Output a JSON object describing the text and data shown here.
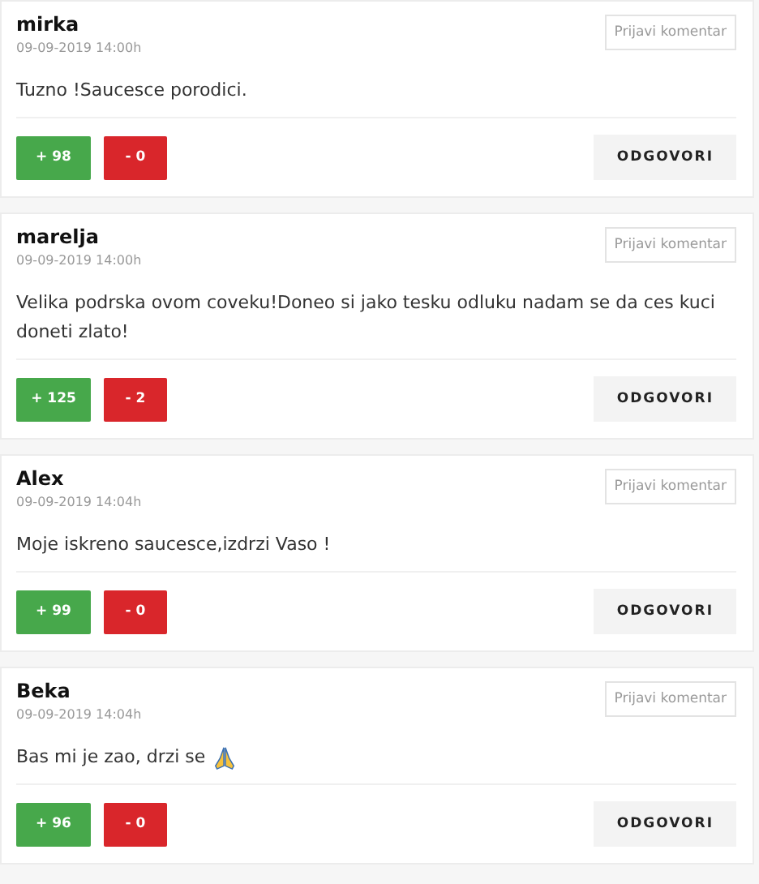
{
  "comments": [
    {
      "author": "mirka",
      "date": "09-09-2019 14:00h",
      "text": "Tuzno !Saucesce porodici.",
      "emoji": false,
      "report": "Prijavi komentar",
      "likes": "+ 98",
      "dislikes": "- 0",
      "reply": "ODGOVORI"
    },
    {
      "author": "marelja",
      "date": "09-09-2019 14:00h",
      "text": "Velika podrska ovom coveku!Doneo si jako tesku odluku nadam se da ces kuci doneti zlato!",
      "emoji": false,
      "report": "Prijavi komentar",
      "likes": "+ 125",
      "dislikes": "- 2",
      "reply": "ODGOVORI"
    },
    {
      "author": "Alex",
      "date": "09-09-2019 14:04h",
      "text": "Moje iskreno saucesce,izdrzi Vaso !",
      "emoji": false,
      "report": "Prijavi komentar",
      "likes": "+ 99",
      "dislikes": "- 0",
      "reply": "ODGOVORI"
    },
    {
      "author": "Beka",
      "date": "09-09-2019 14:04h",
      "text": "Bas mi je zao, drzi se",
      "emoji": true,
      "report": "Prijavi komentar",
      "likes": "+ 96",
      "dislikes": "- 0",
      "reply": "ODGOVORI"
    }
  ]
}
